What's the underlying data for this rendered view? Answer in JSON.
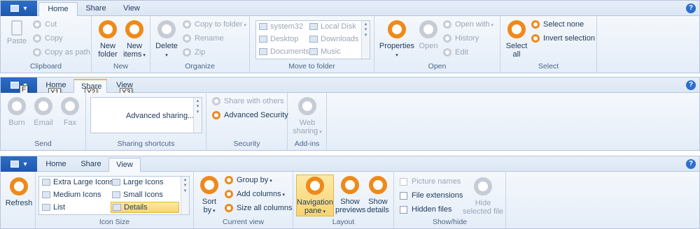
{
  "colors": {
    "accent": "#ee8a1a",
    "disabled": "#c5ccd6",
    "selected": "#f8d374",
    "file_tab": "#1c58b0"
  },
  "ribbon1": {
    "tabs": [
      "Home",
      "Share",
      "View"
    ],
    "groups": {
      "clipboard": {
        "label": "Clipboard",
        "paste": "Paste",
        "cut": "Cut",
        "copy": "Copy",
        "copy_as_path": "Copy as path"
      },
      "new": {
        "label": "New",
        "new_folder_1": "New",
        "new_folder_2": "folder",
        "new_items_1": "New",
        "new_items_2": "items"
      },
      "organize": {
        "label": "Organize",
        "delete": "Delete",
        "copy_to_folder": "Copy to folder",
        "rename": "Rename",
        "zip": "Zip"
      },
      "move_to_folder": {
        "label": "Move to folder",
        "items": [
          "system32",
          "Local Disk",
          "Desktop",
          "Downloads",
          "Documents",
          "Music"
        ]
      },
      "open": {
        "label": "Open",
        "properties": "Properties",
        "open": "Open",
        "open_with": "Open with",
        "history": "History",
        "edit": "Edit"
      },
      "select": {
        "label": "Select",
        "select_all_1": "Select",
        "select_all_2": "all",
        "select_none": "Select none",
        "invert_selection": "Invert selection"
      }
    }
  },
  "ribbon2": {
    "tabs": [
      "Home",
      "Share",
      "View"
    ],
    "keytips": [
      "F",
      "Y1",
      "Y2",
      "Y3"
    ],
    "groups": {
      "send": {
        "label": "Send",
        "burn": "Burn",
        "email": "Email",
        "fax": "Fax"
      },
      "sharing_shortcuts": {
        "label": "Sharing shortcuts",
        "advanced_sharing": "Advanced sharing..."
      },
      "security": {
        "label": "Security",
        "share_with_others": "Share with others",
        "advanced_security": "Advanced Security"
      },
      "addins": {
        "label": "Add-ins",
        "web_sharing_1": "Web",
        "web_sharing_2": "sharing"
      }
    }
  },
  "ribbon3": {
    "tabs": [
      "Home",
      "Share",
      "View"
    ],
    "groups": {
      "refresh": {
        "label": "Refresh"
      },
      "icon_size": {
        "label": "Icon Size",
        "items": [
          "Extra Large Icons",
          "Large Icons",
          "Medium Icons",
          "Small Icons",
          "List",
          "Details"
        ]
      },
      "current_view": {
        "label": "Current view",
        "sort_by_1": "Sort",
        "sort_by_2": "by",
        "group_by": "Group by",
        "add_columns": "Add columns",
        "size_all_columns": "Size all columns"
      },
      "layout": {
        "label": "Layout",
        "nav_pane_1": "Navigation",
        "nav_pane_2": "pane",
        "show_previews_1": "Show",
        "show_previews_2": "previews",
        "show_details_1": "Show",
        "show_details_2": "details"
      },
      "show_hide": {
        "label": "Show/hide",
        "picture_names": "Picture names",
        "file_extensions": "File extensions",
        "hidden_files": "Hidden files",
        "hide_selected_1": "Hide",
        "hide_selected_2": "selected file"
      }
    }
  },
  "help_glyph": "?"
}
